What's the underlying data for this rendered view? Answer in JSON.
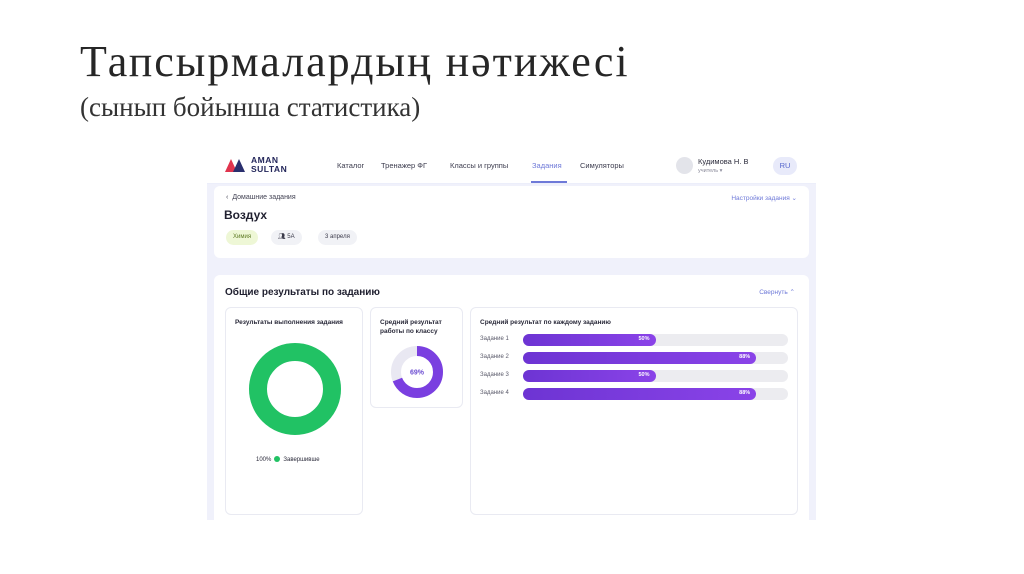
{
  "slide": {
    "title": "Тапсырмалардың нәтижесі",
    "subtitle": "(сынып бойынша статистика)"
  },
  "app": {
    "logo_line1": "AMAN",
    "logo_line2": "SULTAN",
    "nav": [
      {
        "label": "Каталог",
        "active": false
      },
      {
        "label": "Тренажер ФГ",
        "active": false
      },
      {
        "label": "Классы и группы",
        "active": false
      },
      {
        "label": "Задания",
        "active": true
      },
      {
        "label": "Симуляторы",
        "active": false
      }
    ],
    "user": {
      "name": "Кудимова Н. В",
      "role": "учитель ▾"
    },
    "lang": "RU",
    "accent": "#6e79d8"
  },
  "header": {
    "breadcrumb": "Домашние задания",
    "title": "Воздух",
    "settings_link": "Настройки задания",
    "chips": {
      "subject": "Химия",
      "class": "5А",
      "date": "3 апреля"
    }
  },
  "results": {
    "title": "Общие результаты по заданию",
    "collapse_link": "Свернуть",
    "completion": {
      "title": "Результаты выполнения задания",
      "percent_label": "100%",
      "percent": 100,
      "legend_label": "Завершивше",
      "color": "#21c264"
    },
    "average": {
      "title": "Средний результат работы по классу",
      "percent_label": "69%",
      "percent": 69,
      "color": "#7a3fe0"
    },
    "per_task": {
      "title": "Средний результат по каждому заданию",
      "bars": [
        {
          "label": "Задание 1",
          "value_label": "50%",
          "value": 50
        },
        {
          "label": "Задание 2",
          "value_label": "88%",
          "value": 88
        },
        {
          "label": "Задание 3",
          "value_label": "50%",
          "value": 50
        },
        {
          "label": "Задание 4",
          "value_label": "88%",
          "value": 88
        }
      ]
    }
  }
}
